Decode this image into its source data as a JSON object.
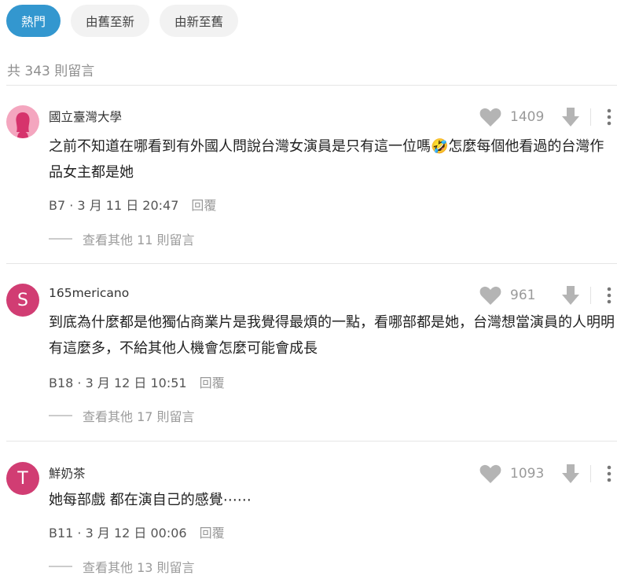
{
  "tabs": [
    {
      "label": "熱門",
      "active": true
    },
    {
      "label": "由舊至新",
      "active": false
    },
    {
      "label": "由新至舊",
      "active": false
    }
  ],
  "comment_count": "共 343 則留言",
  "comments": [
    {
      "author": "國立臺灣大學",
      "avatar_letter": "",
      "likes": "1409",
      "text_before_emoji": "之前不知道在哪看到有外國人問說台灣女演員是只有這一位嗎",
      "emoji": "🤣",
      "text_after_emoji": "怎麼每個他看過的台灣作品女主都是她",
      "floor": "B7",
      "date": "3 月 11 日 20:47",
      "reply_label": "回覆",
      "more_replies": "查看其他 11 則留言"
    },
    {
      "author": "165mericano",
      "avatar_letter": "S",
      "likes": "961",
      "text": "到底為什麼都是他獨佔商業片是我覺得最煩的一點，看哪部都是她，台灣想當演員的人明明有這麼多，不給其他人機會怎麼可能會成長",
      "floor": "B18",
      "date": "3 月 12 日 10:51",
      "reply_label": "回覆",
      "more_replies": "查看其他 17 則留言"
    },
    {
      "author": "鮮奶茶",
      "avatar_letter": "T",
      "likes": "1093",
      "text": "她每部戲 都在演自己的感覺⋯⋯",
      "floor": "B11",
      "date": "3 月 12 日 00:06",
      "reply_label": "回覆",
      "more_replies": "查看其他 13 則留言"
    }
  ],
  "icons": {
    "heart": "heart-icon",
    "downvote": "downvote-arrow-icon",
    "more": "more-vertical-icon"
  },
  "colors": {
    "accent": "#3397cf",
    "avatar_letter_bg": "#d13d73",
    "avatar_school_bg": "#f4a6bf",
    "icon_gray": "#b4b4b4"
  }
}
